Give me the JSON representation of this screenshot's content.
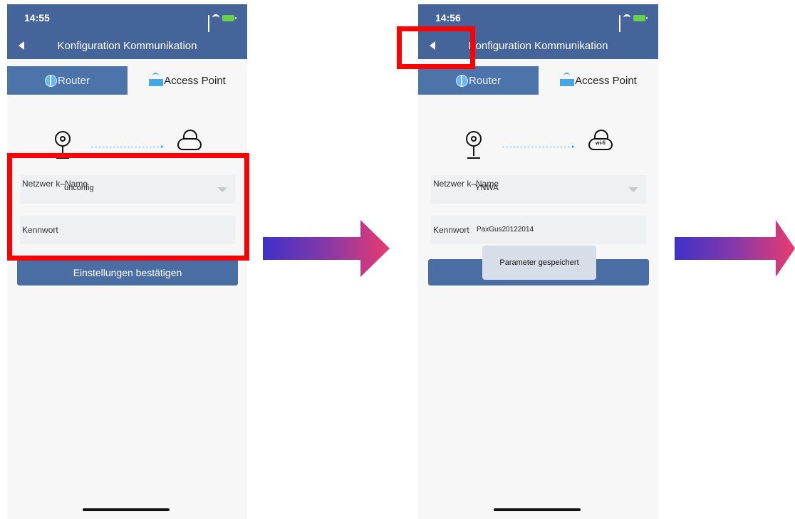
{
  "phones": [
    {
      "time": "14:55",
      "title": "Konfiguration Kommunikation",
      "tabs": [
        "Router",
        "Access Point"
      ],
      "network_label": "Netzwer k–Name",
      "network_value": "unconfig",
      "password_label": "Kennwort",
      "password_value": "",
      "confirm_label": "Einstellungen bestätigen",
      "cloud_label": ""
    },
    {
      "time": "14:56",
      "title": "Konfiguration Kommunikation",
      "tabs": [
        "Router",
        "Access Point"
      ],
      "network_label": "Netzwer k–Name",
      "network_value": "YNWA",
      "password_label": "Kennwort",
      "password_value": "PaxGus20122014",
      "confirm_label": "",
      "toast": "Parameter gespeichert",
      "cloud_label": "wi-fi"
    }
  ],
  "colors": {
    "header": "#44649a",
    "tab_active": "#4d74aa",
    "highlight": "#ff0000",
    "arrow_start": "#3f31c9",
    "arrow_end": "#e83b6e"
  },
  "icons": [
    "back-icon",
    "globe-icon",
    "access-point-icon",
    "camera-icon",
    "cloud-icon",
    "dropdown-caret-icon"
  ]
}
